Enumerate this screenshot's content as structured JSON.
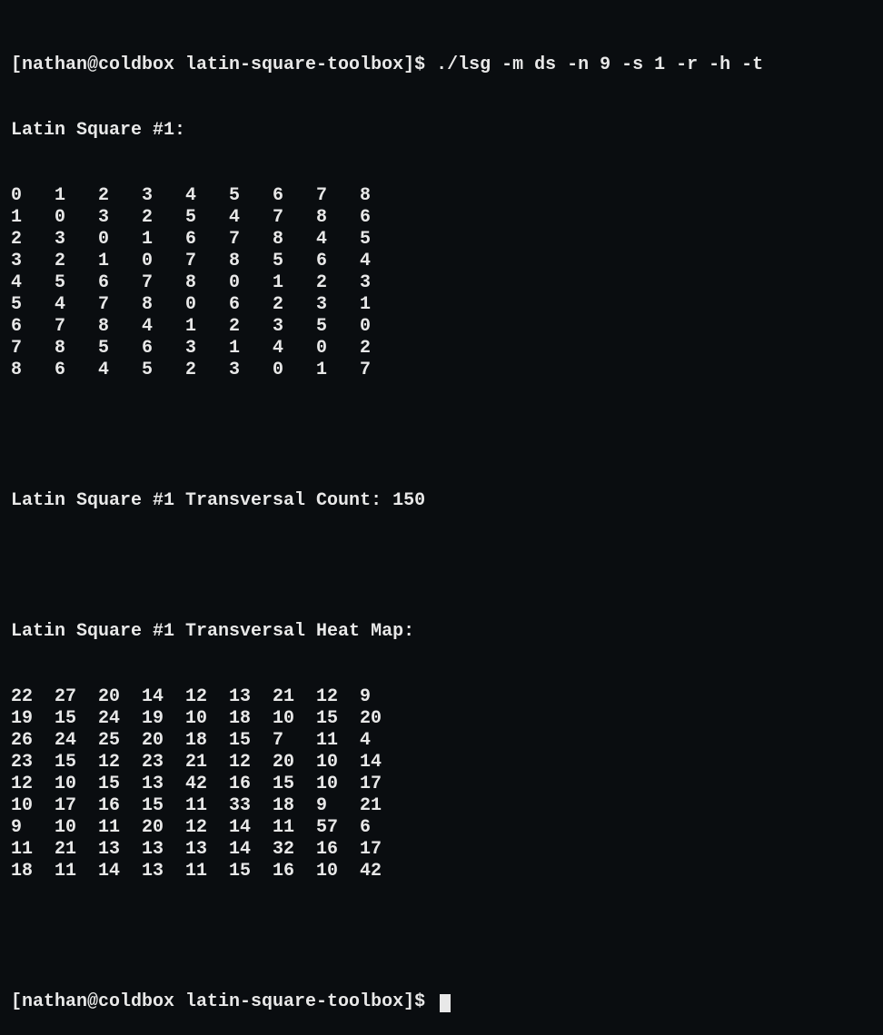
{
  "prompt1": {
    "prefix": "[nathan@coldbox latin-square-toolbox]$ ",
    "command": "./lsg -m ds -n 9 -s 1 -r -h -t"
  },
  "header_square": "Latin Square #1:",
  "square": [
    [
      "0",
      "1",
      "2",
      "3",
      "4",
      "5",
      "6",
      "7",
      "8"
    ],
    [
      "1",
      "0",
      "3",
      "2",
      "5",
      "4",
      "7",
      "8",
      "6"
    ],
    [
      "2",
      "3",
      "0",
      "1",
      "6",
      "7",
      "8",
      "4",
      "5"
    ],
    [
      "3",
      "2",
      "1",
      "0",
      "7",
      "8",
      "5",
      "6",
      "4"
    ],
    [
      "4",
      "5",
      "6",
      "7",
      "8",
      "0",
      "1",
      "2",
      "3"
    ],
    [
      "5",
      "4",
      "7",
      "8",
      "0",
      "6",
      "2",
      "3",
      "1"
    ],
    [
      "6",
      "7",
      "8",
      "4",
      "1",
      "2",
      "3",
      "5",
      "0"
    ],
    [
      "7",
      "8",
      "5",
      "6",
      "3",
      "1",
      "4",
      "0",
      "2"
    ],
    [
      "8",
      "6",
      "4",
      "5",
      "2",
      "3",
      "0",
      "1",
      "7"
    ]
  ],
  "transversal_count_label": "Latin Square #1 Transversal Count: 150",
  "heat_map_label": "Latin Square #1 Transversal Heat Map:",
  "heat_map": [
    [
      "22",
      "27",
      "20",
      "14",
      "12",
      "13",
      "21",
      "12",
      "9"
    ],
    [
      "19",
      "15",
      "24",
      "19",
      "10",
      "18",
      "10",
      "15",
      "20"
    ],
    [
      "26",
      "24",
      "25",
      "20",
      "18",
      "15",
      "7",
      "11",
      "4"
    ],
    [
      "23",
      "15",
      "12",
      "23",
      "21",
      "12",
      "20",
      "10",
      "14"
    ],
    [
      "12",
      "10",
      "15",
      "13",
      "42",
      "16",
      "15",
      "10",
      "17"
    ],
    [
      "10",
      "17",
      "16",
      "15",
      "11",
      "33",
      "18",
      "9",
      "21"
    ],
    [
      "9",
      "10",
      "11",
      "20",
      "12",
      "14",
      "11",
      "57",
      "6"
    ],
    [
      "11",
      "21",
      "13",
      "13",
      "13",
      "14",
      "32",
      "16",
      "17"
    ],
    [
      "18",
      "11",
      "14",
      "13",
      "11",
      "15",
      "16",
      "10",
      "42"
    ]
  ],
  "prompt2": {
    "prefix": "[nathan@coldbox latin-square-toolbox]$ "
  }
}
